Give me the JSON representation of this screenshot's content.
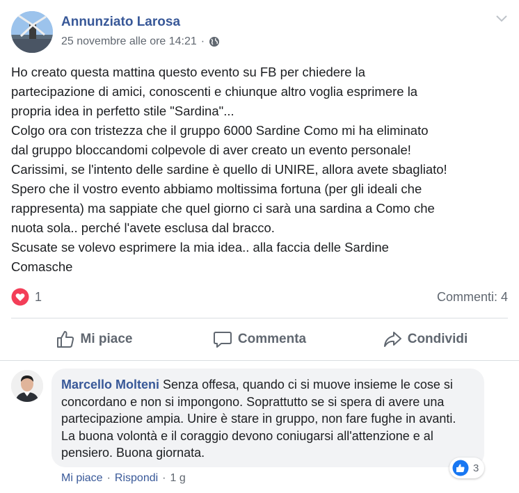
{
  "post": {
    "author": "Annunziato Larosa",
    "timestamp": "25 novembre alle ore 14:21",
    "separator": "·",
    "privacy_icon": "globe-icon",
    "options_icon": "chevron-down-icon",
    "text": "Ho creato questa mattina questo evento su FB per chiedere la\npartecipazione di amici, conoscenti e chiunque altro voglia esprimere la\npropria idea in perfetto stile \"Sardina\"...\nColgo ora con tristezza che il gruppo 6000 Sardine Como mi ha eliminato\ndal gruppo bloccandomi colpevole di aver creato un evento personale!\nCarissimi, se l'intento delle sardine è quello di UNIRE, allora avete sbagliato!\nSpero che il vostro evento abbiamo moltissima fortuna (per gli ideali che\nrappresenta) ma sappiate che quel giorno ci sarà una sardina a Como che\nnuota sola.. perché l'avete esclusa dal bracco.\nScusate se volevo esprimere la mia idea.. alla faccia delle Sardine\nComasche"
  },
  "reactions": {
    "icon": "heart-icon",
    "count": "1",
    "comments_label": "Commenti: 4"
  },
  "actions": {
    "like": "Mi piace",
    "comment": "Commenta",
    "share": "Condividi"
  },
  "comment": {
    "author": "Marcello Molteni",
    "text": " Senza offesa, quando ci si muove insieme le cose si concordano e non si impongono. Soprattutto se si spera di avere una partecipazione ampia. Unire è stare in gruppo, non fare fughe in avanti. La buona volontà e il coraggio devono coniugarsi all'attenzione e al pensiero. Buona giornata.",
    "reaction_count": "3",
    "like_label": "Mi piace",
    "reply_label": "Rispondi",
    "separator": "·",
    "time": "1 g"
  },
  "colors": {
    "link_blue": "#385898",
    "meta_gray": "#606770",
    "heart_red": "#f33e58",
    "like_blue": "#1877f2",
    "bubble_bg": "#f2f3f5"
  }
}
